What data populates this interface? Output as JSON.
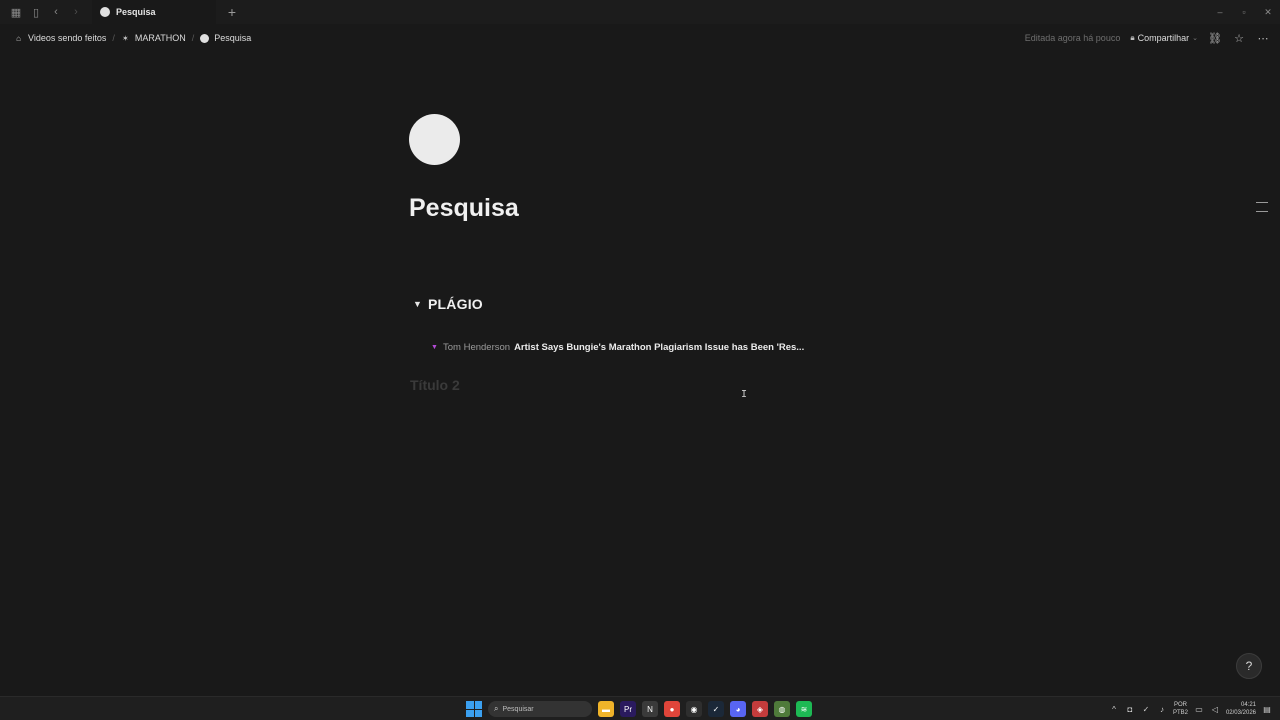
{
  "window": {
    "tab_title": "Pesquisa",
    "new_tab": "+",
    "controls": {
      "minimize": "–",
      "maximize": "▫",
      "close": "✕"
    }
  },
  "breadcrumb": {
    "items": [
      {
        "label": "Videos sendo feitos",
        "icon": "house-icon"
      },
      {
        "label": "MARATHON",
        "icon": "runner-icon"
      },
      {
        "label": "Pesquisa",
        "icon": "circle-icon"
      }
    ],
    "separator": "/"
  },
  "topbar": {
    "edited": "Editada agora há pouco",
    "share_label": "Compartilhar"
  },
  "page": {
    "title": "Pesquisa",
    "toggle": {
      "label": "PLÁGIO",
      "link": {
        "author": "Tom Henderson",
        "title": "Artist Says Bungie's Marathon Plagiarism Issue has Been 'Res..."
      }
    },
    "placeholder_heading": "Título 2",
    "help_icon": "?"
  },
  "taskbar": {
    "search_placeholder": "Pesquisar",
    "apps": [
      {
        "name": "file-explorer-icon",
        "color": "#f0b429",
        "glyph": "▬"
      },
      {
        "name": "premiere-icon",
        "color": "#2a1a5e",
        "glyph": "Pr"
      },
      {
        "name": "notion-icon",
        "color": "#3a3a3a",
        "glyph": "N"
      },
      {
        "name": "chrome-icon",
        "color": "#e0453a",
        "glyph": "●"
      },
      {
        "name": "obs-icon",
        "color": "#2e2e2e",
        "glyph": "◉"
      },
      {
        "name": "steam-icon",
        "color": "#1b2838",
        "glyph": "✓"
      },
      {
        "name": "discord-icon",
        "color": "#5865f2",
        "glyph": "◕"
      },
      {
        "name": "app-red-icon",
        "color": "#c43c3c",
        "glyph": "◈"
      },
      {
        "name": "app-green-icon",
        "color": "#4f7a3a",
        "glyph": "◍"
      },
      {
        "name": "spotify-icon",
        "color": "#1db954",
        "glyph": "≋"
      }
    ],
    "tray": {
      "lang_top": "POR",
      "lang_bottom": "PTB2",
      "time": "04:21",
      "date": "02/03/2026"
    }
  }
}
